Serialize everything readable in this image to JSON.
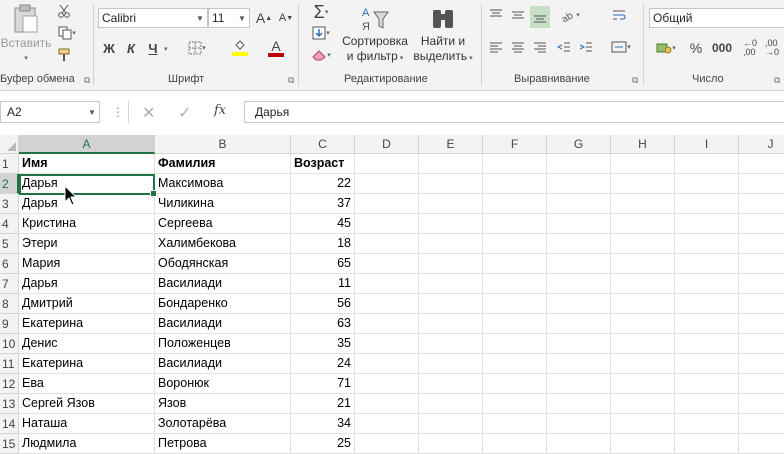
{
  "ribbon": {
    "clipboard": {
      "paste_label": "Вставить",
      "group_label": "Буфер обмена"
    },
    "font": {
      "font_name": "Calibri",
      "font_size": "11",
      "bold_label": "Ж",
      "italic_label": "К",
      "underline_label": "Ч",
      "group_label": "Шрифт"
    },
    "editing": {
      "sort_label_1": "Сортировка",
      "sort_label_2": "и фильтр",
      "find_label_1": "Найти и",
      "find_label_2": "выделить",
      "group_label": "Редактирование"
    },
    "alignment": {
      "group_label": "Выравнивание"
    },
    "number": {
      "format": "Общий",
      "percent": "%",
      "thousands": "000",
      "group_label": "Число"
    }
  },
  "formula_bar": {
    "name_box": "A2",
    "fx_label": "fx",
    "content": "Дарья"
  },
  "grid": {
    "columns": [
      "A",
      "B",
      "C",
      "D",
      "E",
      "F",
      "G",
      "H",
      "I",
      "J"
    ],
    "rows": [
      {
        "num": "1",
        "cells": [
          "Имя",
          "Фамилия",
          "Возраст"
        ]
      },
      {
        "num": "2",
        "cells": [
          "Дарья",
          "Максимова",
          "22"
        ]
      },
      {
        "num": "3",
        "cells": [
          "Дарья",
          "Чиликина",
          "37"
        ]
      },
      {
        "num": "4",
        "cells": [
          "Кристина",
          "Сергеева",
          "45"
        ]
      },
      {
        "num": "5",
        "cells": [
          "Этери",
          "Халимбекова",
          "18"
        ]
      },
      {
        "num": "6",
        "cells": [
          "Мария",
          "Ободянская",
          "65"
        ]
      },
      {
        "num": "7",
        "cells": [
          "Дарья",
          "Василиади",
          "11"
        ]
      },
      {
        "num": "8",
        "cells": [
          "Дмитрий",
          "Бондаренко",
          "56"
        ]
      },
      {
        "num": "9",
        "cells": [
          "Екатерина",
          "Василиади",
          "63"
        ]
      },
      {
        "num": "10",
        "cells": [
          "Денис",
          "Положенцев",
          "35"
        ]
      },
      {
        "num": "11",
        "cells": [
          "Екатерина",
          "Василиади",
          "24"
        ]
      },
      {
        "num": "12",
        "cells": [
          "Ева",
          "Воронюк",
          "71"
        ]
      },
      {
        "num": "13",
        "cells": [
          "Сергей Язов",
          "Язов",
          "21"
        ]
      },
      {
        "num": "14",
        "cells": [
          "Наташа",
          "Золотарёва",
          "34"
        ]
      },
      {
        "num": "15",
        "cells": [
          "Людмила",
          "Петрова",
          "25"
        ]
      }
    ],
    "selected_cell": "A2"
  },
  "colors": {
    "accent": "#217346",
    "font_color_bar": "#c00000",
    "highlight_bar": "#ffff00"
  }
}
